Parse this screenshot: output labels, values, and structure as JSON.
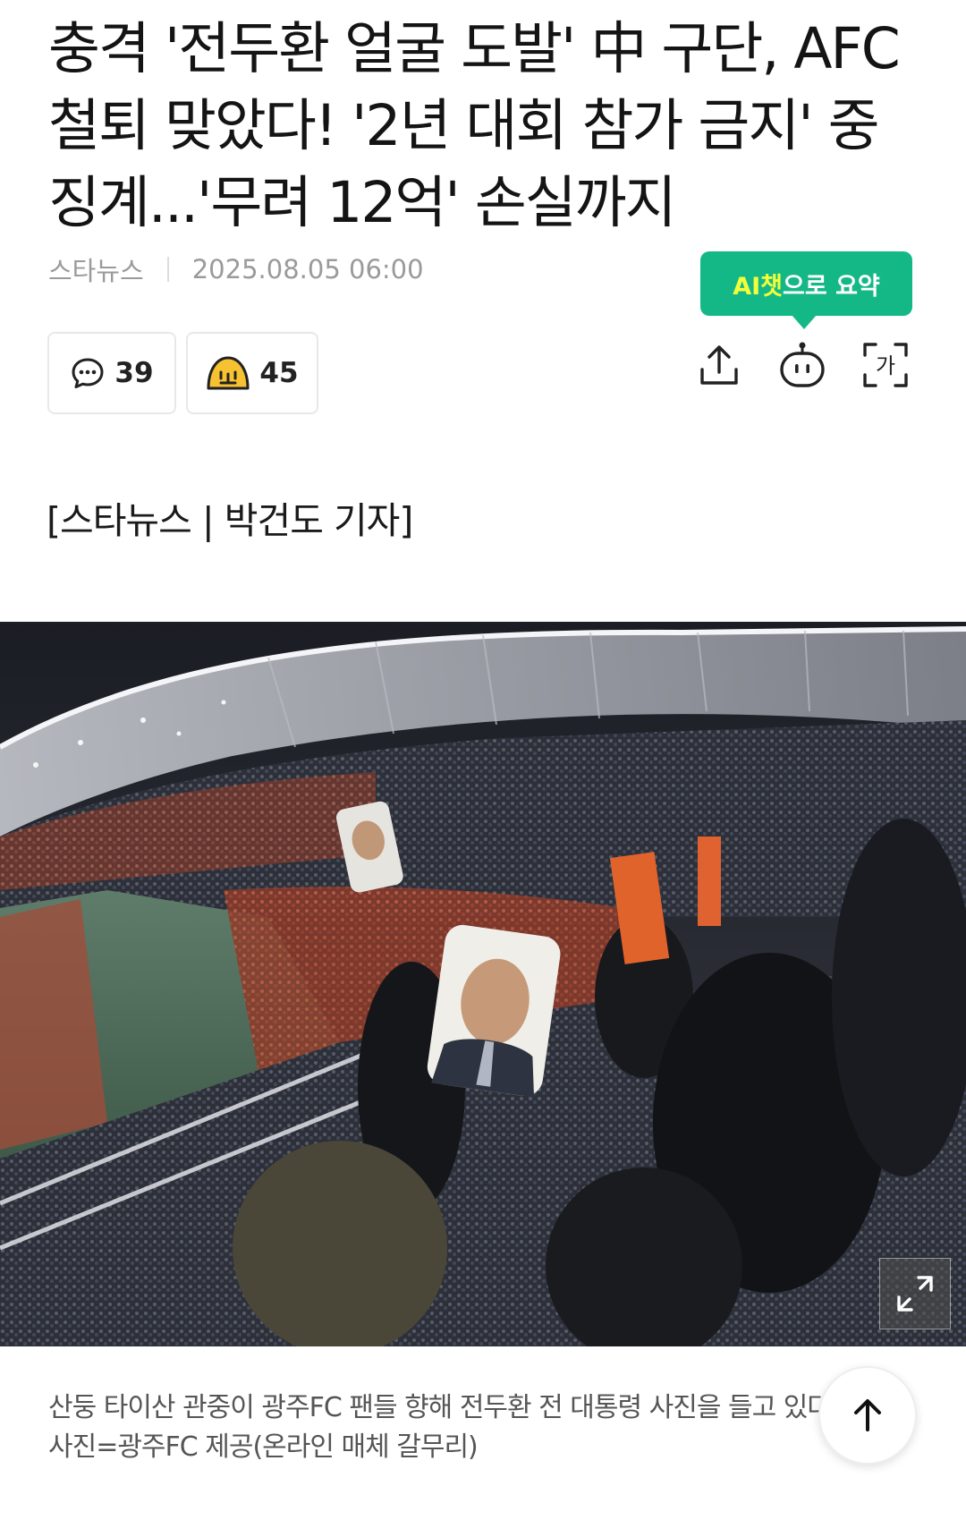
{
  "article": {
    "headline": "충격 '전두환 얼굴 도발' 中 구단, AFC\n철퇴 맞았다! '2년 대회 참가 금지' 중\n징계...'무려 12억' 손실까지",
    "source": "스타뉴스",
    "datetime": "2025.08.05 06:00",
    "reporter": "[스타뉴스 | 박건도 기자]"
  },
  "ai_summary": {
    "label_prefix": "AI챗",
    "label_suffix": "으로 요약"
  },
  "reactions": {
    "comments": "39",
    "likes": "45"
  },
  "toolbar": {
    "share_icon": "share-icon",
    "ai_bot_icon": "ai-chat-bot-icon",
    "font_size_icon": "font-size-icon",
    "font_size_glyph": "가"
  },
  "photo": {
    "caption": "산둥 타이산 관중이 광주FC 팬들 향해 전두환 전 대통령 사진을 들고 있다. /\n사진=광주FC 제공(온라인 매체 갈무리)"
  },
  "colors": {
    "accent_green": "#14b887",
    "highlight_yellow": "#f3ff3a",
    "meta_gray": "#9a9a9a"
  }
}
